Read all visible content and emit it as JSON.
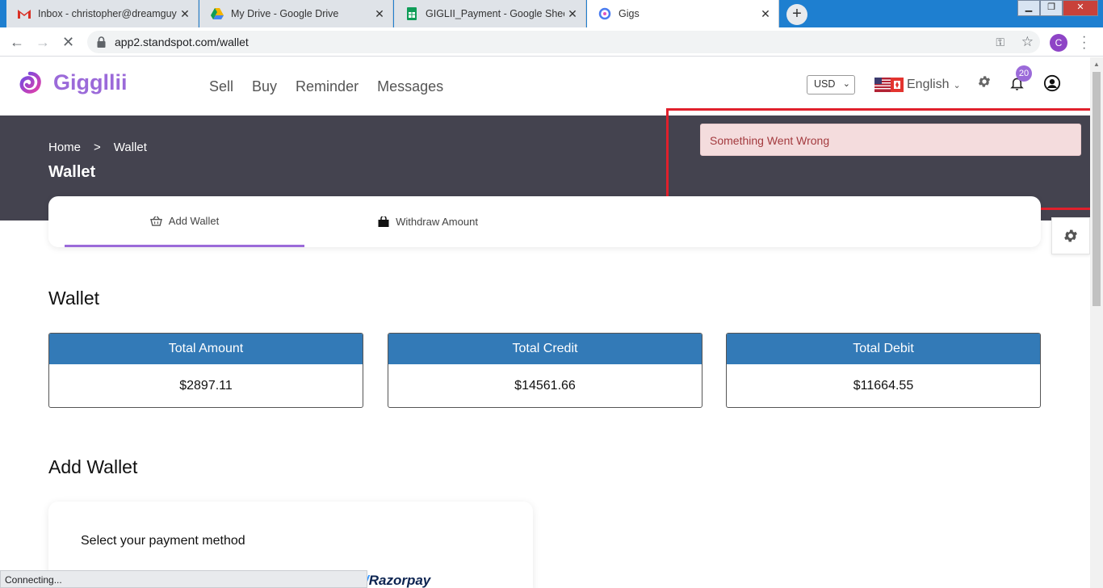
{
  "browser": {
    "tabs": [
      {
        "title": "Inbox - christopher@dreamguys.co.in",
        "icon": "gmail-icon"
      },
      {
        "title": "My Drive - Google Drive",
        "icon": "drive-icon"
      },
      {
        "title": "GIGLII_Payment - Google Sheets",
        "icon": "sheets-icon"
      },
      {
        "title": "Gigs",
        "icon": "gigglii-icon"
      }
    ],
    "active_tab": 3,
    "url": "app2.standspot.com/wallet",
    "profile_initial": "C",
    "status_text": "Connecting..."
  },
  "header": {
    "brand": "Giggllii",
    "nav": [
      "Sell",
      "Buy",
      "Reminder",
      "Messages"
    ],
    "currency": "USD",
    "language": "English",
    "notification_count": "20"
  },
  "banner": {
    "breadcrumb": [
      "Home",
      "Wallet"
    ],
    "breadcrumb_separator": ">",
    "title": "Wallet"
  },
  "toast": {
    "message": "Something Went Wrong"
  },
  "wallet_tabs": [
    "Add Wallet",
    "Withdraw Amount"
  ],
  "wallet": {
    "title": "Wallet",
    "cards": [
      {
        "label": "Total Amount",
        "value": "$2897.11"
      },
      {
        "label": "Total Credit",
        "value": "$14561.66"
      },
      {
        "label": "Total Debit",
        "value": "$11664.55"
      }
    ]
  },
  "add_wallet": {
    "title": "Add Wallet",
    "payment_label": "Select your payment method",
    "provider": "Razorpay"
  },
  "colors": {
    "brand": "#9b6ad9",
    "banner": "#44434f",
    "card_header": "#337ab7",
    "toast_bg": "#f4dcdd",
    "toast_text": "#a33a3e",
    "highlight": "#e0202c"
  }
}
